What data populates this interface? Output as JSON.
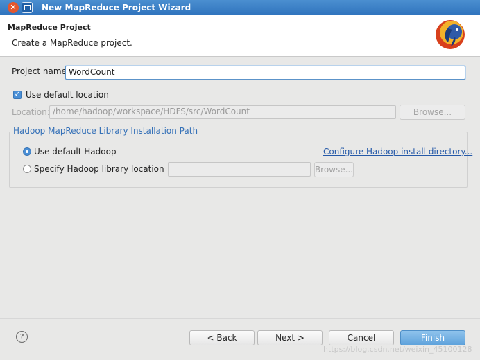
{
  "window": {
    "title": "New MapReduce Project Wizard"
  },
  "header": {
    "title": "MapReduce Project",
    "description": "Create a MapReduce project."
  },
  "project_name": {
    "label": "Project name:",
    "value": "WordCount"
  },
  "use_default_location": {
    "label": "Use default location",
    "checked": true
  },
  "location": {
    "label": "Location:",
    "value": "/home/hadoop/workspace/HDFS/src/WordCount",
    "browse_label": "Browse..."
  },
  "hadoop_group": {
    "title": "Hadoop MapReduce Library Installation Path",
    "default_option": "Use default Hadoop",
    "configure_link": "Configure Hadoop install directory...",
    "specify_option": "Specify Hadoop library location",
    "specify_value": "",
    "browse_label": "Browse..."
  },
  "footer": {
    "help_symbol": "?",
    "back_label": "< Back",
    "next_label": "Next >",
    "cancel_label": "Cancel",
    "finish_label": "Finish"
  },
  "watermark": "https://blog.csdn.net/weixin_45100128",
  "colors": {
    "titlebar": "#2f73bd",
    "accent": "#4a8fd6",
    "link": "#2559a8",
    "group_title": "#3571b8"
  }
}
